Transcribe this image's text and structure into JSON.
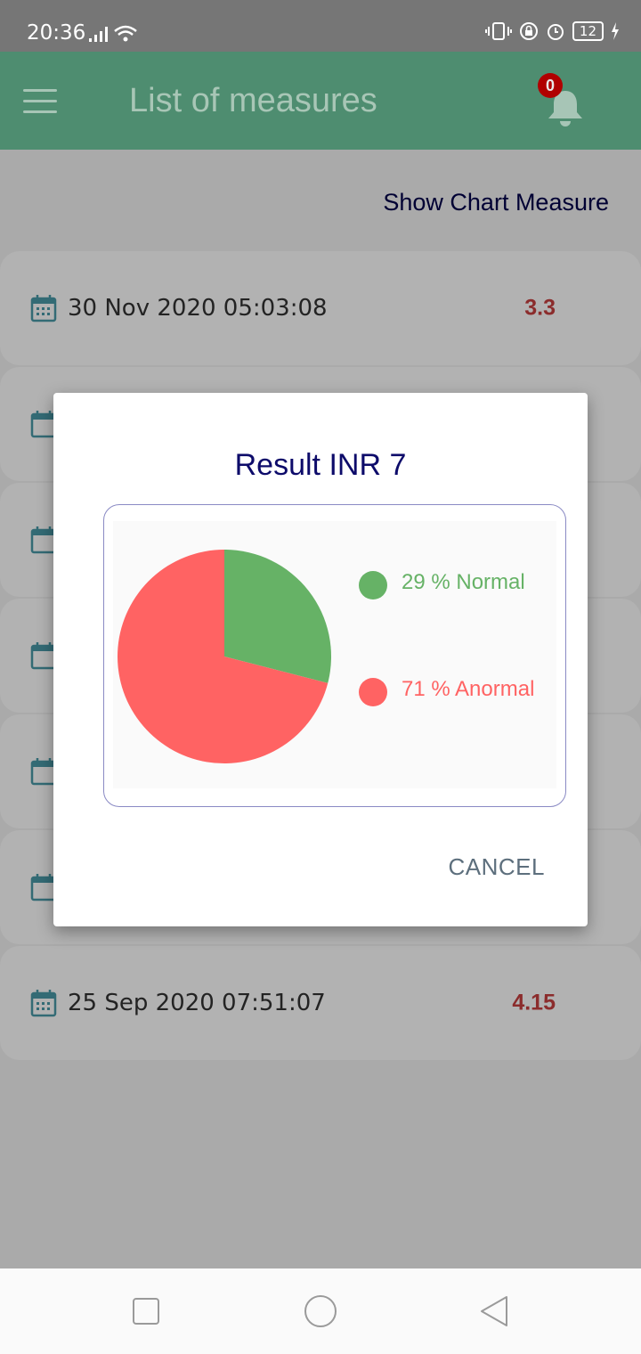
{
  "status_bar": {
    "time": "20:36",
    "battery": "12"
  },
  "app_bar": {
    "title": "List of measures",
    "notification_count": "0"
  },
  "content": {
    "chart_link": "Show Chart Measure",
    "measures": [
      {
        "date": "30 Nov 2020 05:03:08",
        "value": "3.3"
      },
      {
        "date": "25 Sep 2020 07:51:07",
        "value": "4.15"
      }
    ]
  },
  "dialog": {
    "title": "Result INR  7",
    "cancel_label": "CANCEL",
    "legend": [
      {
        "label": "29 % Normal",
        "color": "#66b266"
      },
      {
        "label": "71 % Anormal",
        "color": "#ff6363"
      }
    ]
  },
  "chart_data": {
    "type": "pie",
    "title": "Result INR  7",
    "slices": [
      {
        "label": "Normal",
        "value": 29,
        "color": "#66b266"
      },
      {
        "label": "Anormal",
        "value": 71,
        "color": "#ff6363"
      }
    ]
  },
  "colors": {
    "app_bar": "#4e8d70",
    "accent_text": "#0d0b6a",
    "value_red": "#c84040"
  }
}
